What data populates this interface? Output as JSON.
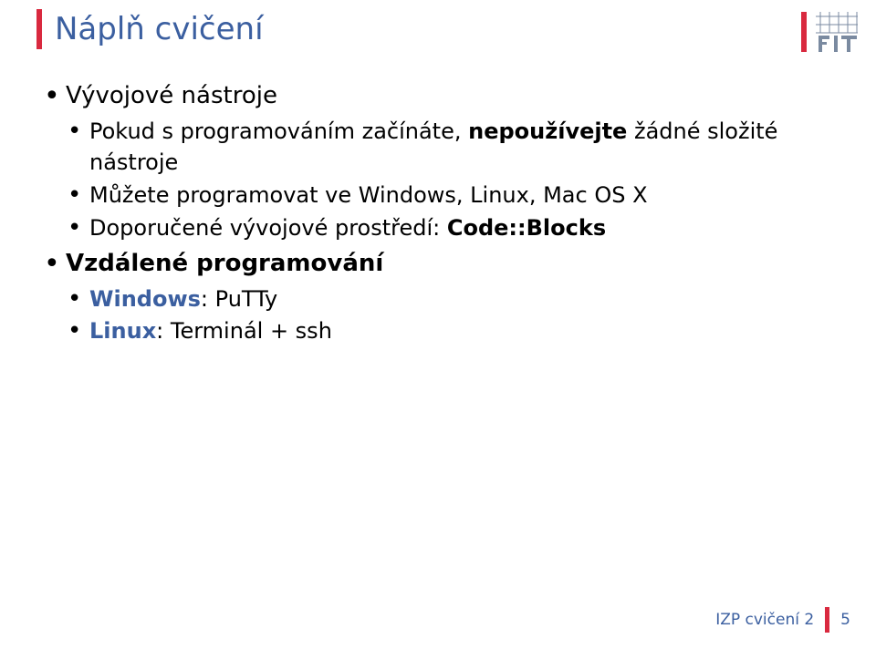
{
  "slide": {
    "title": "Náplň cvičení"
  },
  "content": {
    "l1a": "Vývojové nástroje",
    "l2a_plain1": "Pokud s programováním začínáte, ",
    "l2a_bold": "nepoužívejte",
    "l2a_plain2": " žádné složité nástroje",
    "l2b": "Můžete programovat ve Windows, Linux, Mac OS X",
    "l2c_plain": "Doporučené vývojové prostředí: ",
    "l2c_bold": "Code::Blocks",
    "l1b": "Vzdálené programování",
    "l2d_blue": "Windows",
    "l2d_rest": ": PuTTy",
    "l2e_blue": "Linux",
    "l2e_rest": ": Terminál + ssh"
  },
  "footer": {
    "label": "IZP cvičení 2",
    "page": "5"
  }
}
